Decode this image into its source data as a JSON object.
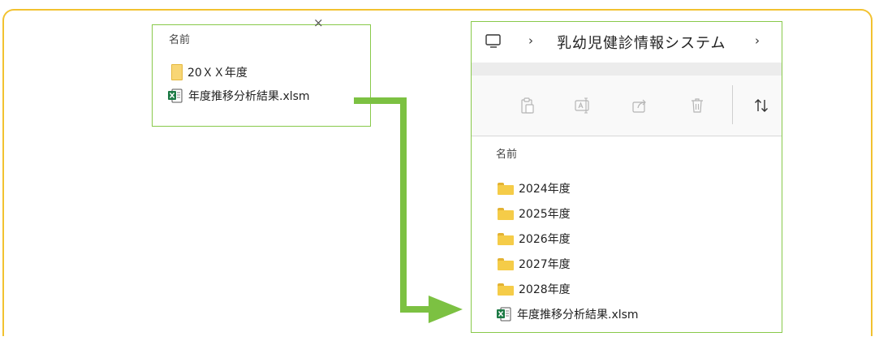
{
  "left_panel": {
    "header": "名前",
    "close_mark": "×",
    "items": [
      {
        "name": "20ＸＸ年度",
        "icon": "folder-icon"
      },
      {
        "name": "年度推移分析結果.xlsm",
        "icon": "excel-macro-icon"
      }
    ]
  },
  "right_panel": {
    "address_bar": {
      "root_icon": "computer-icon",
      "separator": "›",
      "path": "乳幼児健診情報システム",
      "trailing_separator": "›"
    },
    "toolbar": {
      "buttons": [
        "paste-icon",
        "rename-icon",
        "share-icon",
        "delete-icon",
        "sort-icon"
      ]
    },
    "header": "名前",
    "items": [
      {
        "name": "2024年度",
        "icon": "folder-icon"
      },
      {
        "name": "2025年度",
        "icon": "folder-icon"
      },
      {
        "name": "2026年度",
        "icon": "folder-icon"
      },
      {
        "name": "2027年度",
        "icon": "folder-icon"
      },
      {
        "name": "2028年度",
        "icon": "folder-icon"
      },
      {
        "name": "年度推移分析結果.xlsm",
        "icon": "excel-macro-icon"
      }
    ]
  },
  "colors": {
    "frame_border": "#f2c230",
    "panel_border": "#88c94a",
    "arrow": "#7cc142",
    "folder": "#f5cc48",
    "excel_green": "#1d7a45"
  }
}
